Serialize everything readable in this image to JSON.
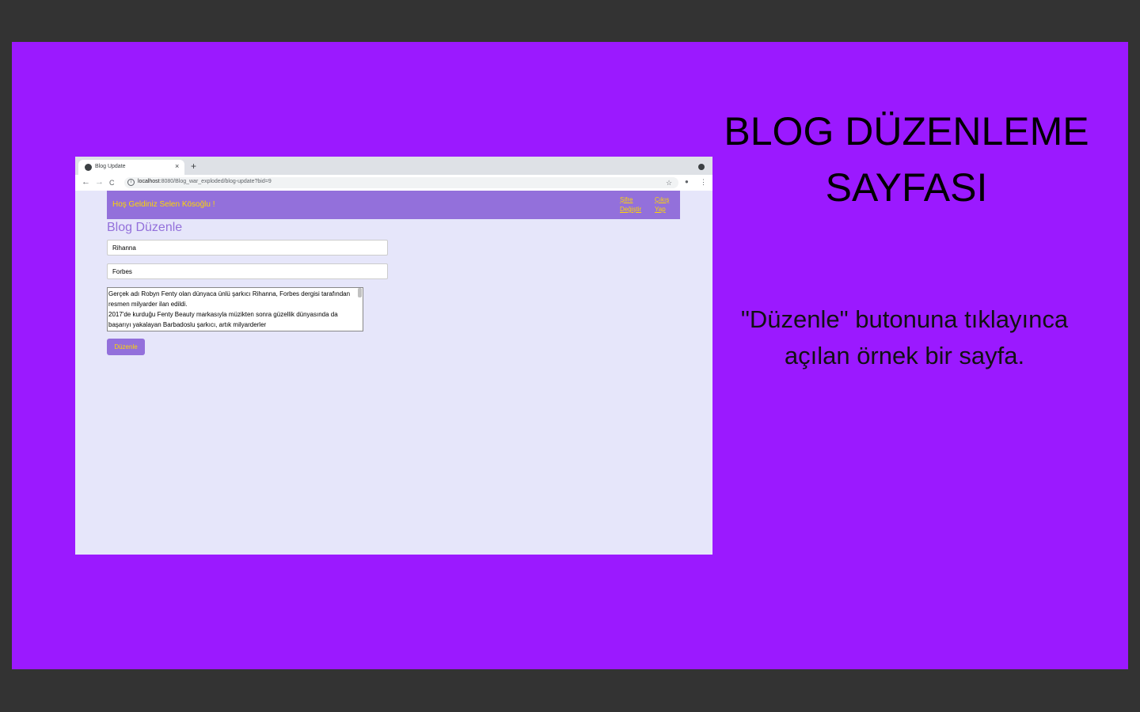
{
  "browser": {
    "tab_title": "Blog Update",
    "tab_close": "×",
    "new_tab": "+",
    "url_host": "localhost",
    "url_path": ":8080/Blog_war_exploded/blog-update?bid=9",
    "back_icon": "←",
    "forward_icon": "→",
    "reload_icon": "C",
    "star_icon": "☆",
    "account_icon": "●",
    "menu_icon": "⋮"
  },
  "site": {
    "welcome": "Hoş Geldiniz Selen Kösoğlu !",
    "change_password": "Şifre Değiştir",
    "logout": "Çıkış Yap",
    "page_title": "Blog Düzenle",
    "title_value": "Rihanna",
    "category_value": "Forbes",
    "content_value": "Gerçek adı Robyn Fenty olan dünyaca ünlü şarkıcı Rihanna, Forbes dergisi tarafından resmen milyarder ilan edildi.\n2017'de kurduğu Fenty Beauty markasıyla müzikten sonra güzellik dünyasında da başarıyı yakalayan Barbadoslu şarkıcı, artık milyarderler",
    "submit_label": "Düzenle"
  },
  "slide": {
    "title": "BLOG DÜZENLEME SAYFASI",
    "description": "\"Düzenle\" butonuna tıklayınca açılan örnek bir sayfa."
  },
  "colors": {
    "slide_bg": "#9b19ff",
    "page_bg": "#e6e6fa",
    "header_bg": "#9370db",
    "accent_text": "#ffd700",
    "frame_bg": "#333333"
  }
}
